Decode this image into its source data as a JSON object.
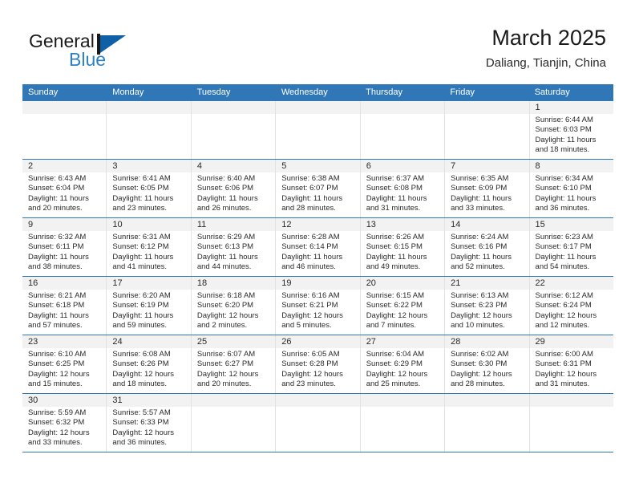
{
  "brand": {
    "line1": "General",
    "line2": "Blue",
    "mark_icon": "general-blue-triangle-logo",
    "color_primary": "#1060A8",
    "color_secondary": "#2E80C4"
  },
  "header": {
    "title": "March 2025",
    "subtitle": "Daliang, Tianjin, China"
  },
  "theme": {
    "header_blue": "#3077B8",
    "band_gray": "#f2f2f2",
    "divider_gray": "#e2e2e2",
    "text": "#2a2a2a"
  },
  "calendar": {
    "weekday_headers": [
      "Sunday",
      "Monday",
      "Tuesday",
      "Wednesday",
      "Thursday",
      "Friday",
      "Saturday"
    ],
    "weeks": [
      [
        {
          "day": "",
          "lines": []
        },
        {
          "day": "",
          "lines": []
        },
        {
          "day": "",
          "lines": []
        },
        {
          "day": "",
          "lines": []
        },
        {
          "day": "",
          "lines": []
        },
        {
          "day": "",
          "lines": []
        },
        {
          "day": "1",
          "lines": [
            "Sunrise: 6:44 AM",
            "Sunset: 6:03 PM",
            "Daylight: 11 hours",
            "and 18 minutes."
          ]
        }
      ],
      [
        {
          "day": "2",
          "lines": [
            "Sunrise: 6:43 AM",
            "Sunset: 6:04 PM",
            "Daylight: 11 hours",
            "and 20 minutes."
          ]
        },
        {
          "day": "3",
          "lines": [
            "Sunrise: 6:41 AM",
            "Sunset: 6:05 PM",
            "Daylight: 11 hours",
            "and 23 minutes."
          ]
        },
        {
          "day": "4",
          "lines": [
            "Sunrise: 6:40 AM",
            "Sunset: 6:06 PM",
            "Daylight: 11 hours",
            "and 26 minutes."
          ]
        },
        {
          "day": "5",
          "lines": [
            "Sunrise: 6:38 AM",
            "Sunset: 6:07 PM",
            "Daylight: 11 hours",
            "and 28 minutes."
          ]
        },
        {
          "day": "6",
          "lines": [
            "Sunrise: 6:37 AM",
            "Sunset: 6:08 PM",
            "Daylight: 11 hours",
            "and 31 minutes."
          ]
        },
        {
          "day": "7",
          "lines": [
            "Sunrise: 6:35 AM",
            "Sunset: 6:09 PM",
            "Daylight: 11 hours",
            "and 33 minutes."
          ]
        },
        {
          "day": "8",
          "lines": [
            "Sunrise: 6:34 AM",
            "Sunset: 6:10 PM",
            "Daylight: 11 hours",
            "and 36 minutes."
          ]
        }
      ],
      [
        {
          "day": "9",
          "lines": [
            "Sunrise: 6:32 AM",
            "Sunset: 6:11 PM",
            "Daylight: 11 hours",
            "and 38 minutes."
          ]
        },
        {
          "day": "10",
          "lines": [
            "Sunrise: 6:31 AM",
            "Sunset: 6:12 PM",
            "Daylight: 11 hours",
            "and 41 minutes."
          ]
        },
        {
          "day": "11",
          "lines": [
            "Sunrise: 6:29 AM",
            "Sunset: 6:13 PM",
            "Daylight: 11 hours",
            "and 44 minutes."
          ]
        },
        {
          "day": "12",
          "lines": [
            "Sunrise: 6:28 AM",
            "Sunset: 6:14 PM",
            "Daylight: 11 hours",
            "and 46 minutes."
          ]
        },
        {
          "day": "13",
          "lines": [
            "Sunrise: 6:26 AM",
            "Sunset: 6:15 PM",
            "Daylight: 11 hours",
            "and 49 minutes."
          ]
        },
        {
          "day": "14",
          "lines": [
            "Sunrise: 6:24 AM",
            "Sunset: 6:16 PM",
            "Daylight: 11 hours",
            "and 52 minutes."
          ]
        },
        {
          "day": "15",
          "lines": [
            "Sunrise: 6:23 AM",
            "Sunset: 6:17 PM",
            "Daylight: 11 hours",
            "and 54 minutes."
          ]
        }
      ],
      [
        {
          "day": "16",
          "lines": [
            "Sunrise: 6:21 AM",
            "Sunset: 6:18 PM",
            "Daylight: 11 hours",
            "and 57 minutes."
          ]
        },
        {
          "day": "17",
          "lines": [
            "Sunrise: 6:20 AM",
            "Sunset: 6:19 PM",
            "Daylight: 11 hours",
            "and 59 minutes."
          ]
        },
        {
          "day": "18",
          "lines": [
            "Sunrise: 6:18 AM",
            "Sunset: 6:20 PM",
            "Daylight: 12 hours",
            "and 2 minutes."
          ]
        },
        {
          "day": "19",
          "lines": [
            "Sunrise: 6:16 AM",
            "Sunset: 6:21 PM",
            "Daylight: 12 hours",
            "and 5 minutes."
          ]
        },
        {
          "day": "20",
          "lines": [
            "Sunrise: 6:15 AM",
            "Sunset: 6:22 PM",
            "Daylight: 12 hours",
            "and 7 minutes."
          ]
        },
        {
          "day": "21",
          "lines": [
            "Sunrise: 6:13 AM",
            "Sunset: 6:23 PM",
            "Daylight: 12 hours",
            "and 10 minutes."
          ]
        },
        {
          "day": "22",
          "lines": [
            "Sunrise: 6:12 AM",
            "Sunset: 6:24 PM",
            "Daylight: 12 hours",
            "and 12 minutes."
          ]
        }
      ],
      [
        {
          "day": "23",
          "lines": [
            "Sunrise: 6:10 AM",
            "Sunset: 6:25 PM",
            "Daylight: 12 hours",
            "and 15 minutes."
          ]
        },
        {
          "day": "24",
          "lines": [
            "Sunrise: 6:08 AM",
            "Sunset: 6:26 PM",
            "Daylight: 12 hours",
            "and 18 minutes."
          ]
        },
        {
          "day": "25",
          "lines": [
            "Sunrise: 6:07 AM",
            "Sunset: 6:27 PM",
            "Daylight: 12 hours",
            "and 20 minutes."
          ]
        },
        {
          "day": "26",
          "lines": [
            "Sunrise: 6:05 AM",
            "Sunset: 6:28 PM",
            "Daylight: 12 hours",
            "and 23 minutes."
          ]
        },
        {
          "day": "27",
          "lines": [
            "Sunrise: 6:04 AM",
            "Sunset: 6:29 PM",
            "Daylight: 12 hours",
            "and 25 minutes."
          ]
        },
        {
          "day": "28",
          "lines": [
            "Sunrise: 6:02 AM",
            "Sunset: 6:30 PM",
            "Daylight: 12 hours",
            "and 28 minutes."
          ]
        },
        {
          "day": "29",
          "lines": [
            "Sunrise: 6:00 AM",
            "Sunset: 6:31 PM",
            "Daylight: 12 hours",
            "and 31 minutes."
          ]
        }
      ],
      [
        {
          "day": "30",
          "lines": [
            "Sunrise: 5:59 AM",
            "Sunset: 6:32 PM",
            "Daylight: 12 hours",
            "and 33 minutes."
          ]
        },
        {
          "day": "31",
          "lines": [
            "Sunrise: 5:57 AM",
            "Sunset: 6:33 PM",
            "Daylight: 12 hours",
            "and 36 minutes."
          ]
        },
        {
          "day": "",
          "lines": []
        },
        {
          "day": "",
          "lines": []
        },
        {
          "day": "",
          "lines": []
        },
        {
          "day": "",
          "lines": []
        },
        {
          "day": "",
          "lines": []
        }
      ]
    ]
  }
}
